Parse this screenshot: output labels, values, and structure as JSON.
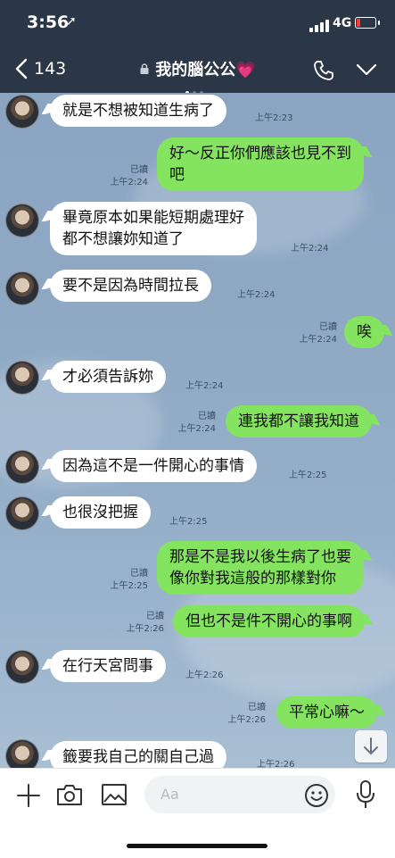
{
  "status": {
    "time": "3:56",
    "network": "4G"
  },
  "header": {
    "back_count": "143",
    "title": "我的腦公公💗"
  },
  "messages": [
    {
      "side": "in",
      "text": "就是不想被知道生病了",
      "time": "上午2:23"
    },
    {
      "side": "out",
      "text": "好～反正你們應該也見不到\n吧",
      "read": "已讀",
      "time": "上午2:24"
    },
    {
      "side": "in",
      "text": "畢竟原本如果能短期處理好\n都不想讓妳知道了",
      "time": "上午2:24"
    },
    {
      "side": "in",
      "text": "要不是因為時間拉長",
      "time": "上午2:24"
    },
    {
      "side": "out",
      "text": "唉",
      "read": "已讀",
      "time": "上午2:24"
    },
    {
      "side": "in",
      "text": "才必須告訴妳",
      "time": "上午2:24"
    },
    {
      "side": "out",
      "text": "連我都不讓我知道",
      "read": "已讀",
      "time": "上午2:24"
    },
    {
      "side": "in",
      "text": "因為這不是一件開心的事情",
      "time": "上午2:25"
    },
    {
      "side": "in",
      "text": "也很沒把握",
      "time": "上午2:25"
    },
    {
      "side": "out",
      "text": "那是不是我以後生病了也要\n像你對我這般的那樣對你",
      "read": "已讀",
      "time": "上午2:25"
    },
    {
      "side": "out",
      "text": "但也不是件不開心的事啊",
      "read": "已讀",
      "time": "上午2:26"
    },
    {
      "side": "in",
      "text": "在行天宮問事",
      "time": "上午2:26"
    },
    {
      "side": "out",
      "text": "平常心嘛～",
      "read": "已讀",
      "time": "上午2:26"
    },
    {
      "side": "in",
      "text": "籤要我自己的關自己過",
      "time": "上午2:26"
    }
  ],
  "input": {
    "placeholder": "Aa"
  },
  "colors": {
    "header_bg": "#2b3646",
    "bubble_out": "#84e45f",
    "bubble_in": "#ffffff"
  }
}
